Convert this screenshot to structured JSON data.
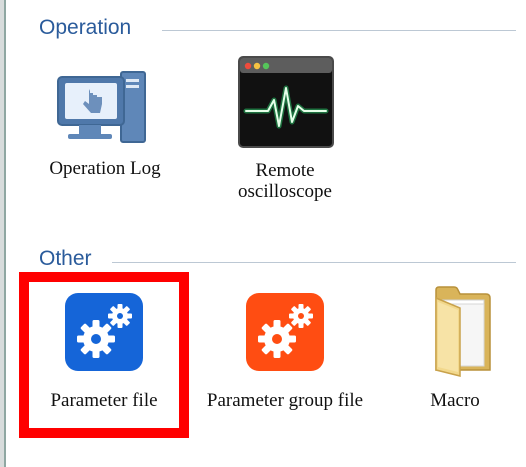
{
  "sections": {
    "operation": {
      "title": "Operation",
      "items": [
        {
          "label": "Operation Log",
          "icon": "operation-log-icon"
        },
        {
          "label": "Remote oscilloscope",
          "icon": "oscilloscope-icon"
        }
      ]
    },
    "other": {
      "title": "Other",
      "items": [
        {
          "label": "Parameter file",
          "icon": "parameter-file-icon",
          "highlighted": true
        },
        {
          "label": "Parameter group file",
          "icon": "parameter-group-file-icon"
        },
        {
          "label": "Macro",
          "icon": "macro-folder-icon"
        }
      ]
    }
  },
  "colors": {
    "section_title": "#2a5b9b",
    "highlight": "#ff0000",
    "param_blue": "#1565d8",
    "param_orange": "#ff4d12"
  }
}
